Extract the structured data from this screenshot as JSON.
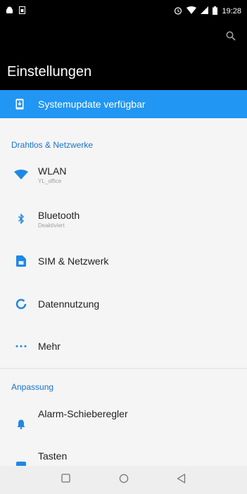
{
  "status_bar": {
    "time": "19:28",
    "icons": [
      "android-icon",
      "sim-icon",
      "alarm-icon",
      "wifi-icon",
      "signal-icon",
      "battery-icon"
    ]
  },
  "toolbar": {
    "title": "Einstellungen",
    "search_icon": "search-icon"
  },
  "update_banner": {
    "label": "Systemupdate verfügbar",
    "icon": "phone-update-icon",
    "color": "#2196f3"
  },
  "sections": [
    {
      "header": "Drahtlos & Netzwerke",
      "items": [
        {
          "title": "WLAN",
          "subtitle": "YL_office",
          "icon": "wifi-icon"
        },
        {
          "title": "Bluetooth",
          "subtitle": "Deaktiviert",
          "icon": "bluetooth-icon"
        },
        {
          "title": "SIM & Netzwerk",
          "subtitle": "",
          "icon": "sim-card-icon"
        },
        {
          "title": "Datennutzung",
          "subtitle": "",
          "icon": "data-usage-icon"
        },
        {
          "title": "Mehr",
          "subtitle": "",
          "icon": "more-icon"
        }
      ]
    },
    {
      "header": "Anpassung",
      "items": [
        {
          "title": "Alarm-Schieberegler",
          "subtitle": "",
          "icon": "bell-icon"
        },
        {
          "title": "Tasten",
          "subtitle": "",
          "icon": "keys-icon"
        }
      ]
    }
  ],
  "nav_bar": {
    "buttons": [
      "recents-icon",
      "home-icon",
      "back-icon"
    ]
  },
  "colors": {
    "accent": "#2196f3",
    "section_header": "#1a73c8",
    "status_bar": "#000000"
  }
}
